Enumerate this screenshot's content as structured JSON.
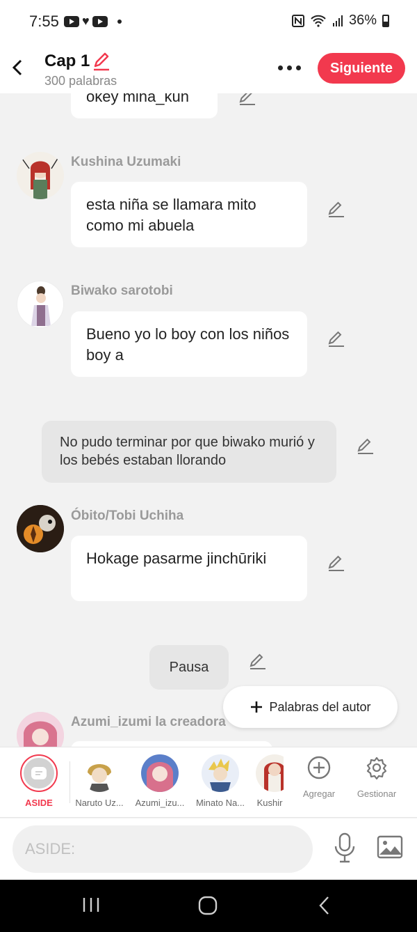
{
  "status_bar": {
    "time": "7:55",
    "battery": "36%"
  },
  "header": {
    "title": "Cap 1",
    "word_count": "300 palabras",
    "next_label": "Siguiente"
  },
  "messages": {
    "top_bubble": "okey mina_kun",
    "m1": {
      "name": "Kushina Uzumaki",
      "text": "esta niña se llamara mito como mi abuela"
    },
    "m2": {
      "name": "Biwako sarotobi",
      "text": "Bueno yo lo boy con los niños boy a"
    },
    "narration": "No pudo terminar  por que biwako murió y los bebés estaban llorando",
    "m3": {
      "name": "Óbito/Tobi Uchiha",
      "text": "Hokage pasarme jinchūriki"
    },
    "pause": "Pausa",
    "m4": {
      "name": "Azumi_izumi la creadora"
    }
  },
  "float_button": {
    "label": "Palabras del autor"
  },
  "characters": [
    {
      "label": "ASIDE"
    },
    {
      "label": "Naruto Uz..."
    },
    {
      "label": "Azumi_izu..."
    },
    {
      "label": "Minato Na..."
    },
    {
      "label": "Kushir"
    }
  ],
  "tools": {
    "add_label": "Agregar",
    "manage_label": "Gestionar"
  },
  "input": {
    "placeholder": "ASIDE:"
  },
  "colors": {
    "accent": "#f2394e",
    "background": "#f2f2f2"
  }
}
